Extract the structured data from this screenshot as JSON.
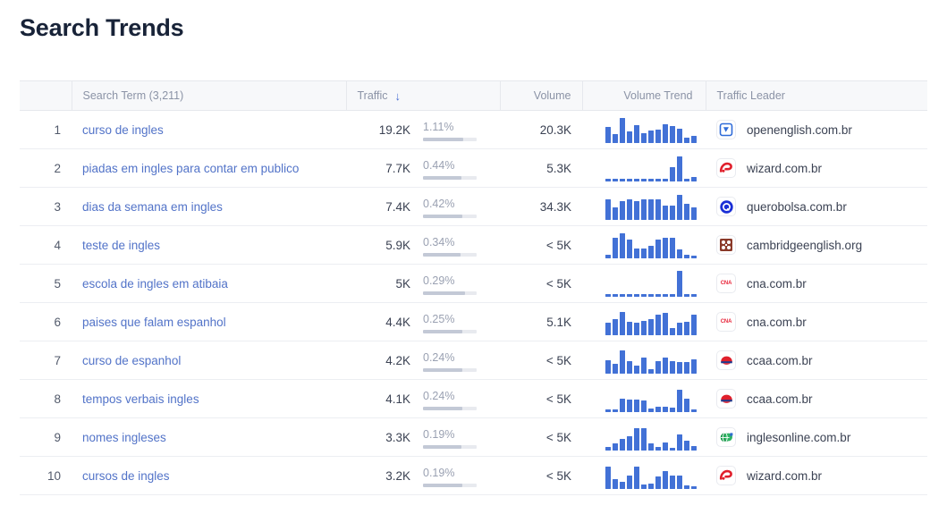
{
  "page": {
    "title": "Search Trends",
    "accent_blue": "#4271d6",
    "link_blue": "#5273c8",
    "header_bg": "#f7f8fa",
    "text_dark": "#182338"
  },
  "table": {
    "columns": [
      {
        "key": "rank",
        "label": ""
      },
      {
        "key": "term",
        "label": "Search Term (3,211)"
      },
      {
        "key": "traffic",
        "label": "Traffic",
        "sorted": true,
        "sort_dir": "desc",
        "sort_icon": "arrow-down-icon"
      },
      {
        "key": "volume",
        "label": "Volume"
      },
      {
        "key": "trend",
        "label": "Volume Trend"
      },
      {
        "key": "leader",
        "label": "Traffic Leader"
      }
    ],
    "rows": [
      {
        "rank": "1",
        "term": "curso de ingles",
        "traffic": "19.2K",
        "percent": "1.11%",
        "percent_fill": 75,
        "volume": "20.3K",
        "leader": "openenglish.com.br",
        "favicon": "openenglish-icon",
        "trend": [
          14,
          8,
          22,
          10,
          16,
          9,
          11,
          12,
          17,
          15,
          13,
          5,
          6
        ]
      },
      {
        "rank": "2",
        "term": "piadas em ingles para contar em publico",
        "traffic": "7.7K",
        "percent": "0.44%",
        "percent_fill": 72,
        "volume": "5.3K",
        "leader": "wizard.com.br",
        "favicon": "wizard-icon",
        "trend": [
          2,
          2,
          2,
          2,
          2,
          2,
          2,
          2,
          2,
          13,
          22,
          2,
          4
        ]
      },
      {
        "rank": "3",
        "term": "dias da semana em ingles",
        "traffic": "7.4K",
        "percent": "0.42%",
        "percent_fill": 73,
        "volume": "34.3K",
        "leader": "querobolsa.com.br",
        "favicon": "querobolsa-icon",
        "trend": [
          18,
          11,
          17,
          18,
          17,
          18,
          18,
          18,
          13,
          13,
          22,
          14,
          11
        ]
      },
      {
        "rank": "4",
        "term": "teste de ingles",
        "traffic": "5.9K",
        "percent": "0.34%",
        "percent_fill": 70,
        "volume": "< 5K",
        "leader": "cambridgeenglish.org",
        "favicon": "cambridge-icon",
        "trend": [
          3,
          18,
          22,
          17,
          9,
          9,
          11,
          17,
          18,
          18,
          8,
          3,
          2
        ]
      },
      {
        "rank": "5",
        "term": "escola de ingles em atibaia",
        "traffic": "5K",
        "percent": "0.29%",
        "percent_fill": 78,
        "volume": "< 5K",
        "leader": "cna.com.br",
        "favicon": "cna-icon",
        "trend": [
          2,
          2,
          2,
          2,
          2,
          2,
          2,
          2,
          2,
          2,
          23,
          2,
          2
        ]
      },
      {
        "rank": "6",
        "term": "paises que falam espanhol",
        "traffic": "4.4K",
        "percent": "0.25%",
        "percent_fill": 74,
        "volume": "5.1K",
        "leader": "cna.com.br",
        "favicon": "cna-icon",
        "trend": [
          11,
          14,
          21,
          12,
          11,
          13,
          14,
          18,
          20,
          6,
          11,
          12,
          18
        ]
      },
      {
        "rank": "7",
        "term": "curso de espanhol",
        "traffic": "4.2K",
        "percent": "0.24%",
        "percent_fill": 74,
        "volume": "< 5K",
        "leader": "ccaa.com.br",
        "favicon": "ccaa-icon",
        "trend": [
          12,
          9,
          21,
          11,
          7,
          14,
          4,
          11,
          14,
          11,
          10,
          10,
          13
        ]
      },
      {
        "rank": "8",
        "term": "tempos verbais ingles",
        "traffic": "4.1K",
        "percent": "0.24%",
        "percent_fill": 74,
        "volume": "< 5K",
        "leader": "ccaa.com.br",
        "favicon": "ccaa-icon",
        "trend": [
          2,
          2,
          12,
          11,
          11,
          10,
          3,
          5,
          5,
          4,
          20,
          12,
          2
        ]
      },
      {
        "rank": "9",
        "term": "nomes ingleses",
        "traffic": "3.3K",
        "percent": "0.19%",
        "percent_fill": 72,
        "volume": "< 5K",
        "leader": "inglesonline.com.br",
        "favicon": "inglesonline-icon",
        "trend": [
          3,
          6,
          10,
          13,
          20,
          20,
          6,
          3,
          7,
          2,
          14,
          9,
          4
        ]
      },
      {
        "rank": "10",
        "term": "cursos de ingles",
        "traffic": "3.2K",
        "percent": "0.19%",
        "percent_fill": 73,
        "volume": "< 5K",
        "leader": "wizard.com.br",
        "favicon": "wizard-icon",
        "trend": [
          20,
          9,
          6,
          12,
          20,
          4,
          5,
          11,
          16,
          12,
          12,
          3,
          2
        ]
      }
    ]
  }
}
